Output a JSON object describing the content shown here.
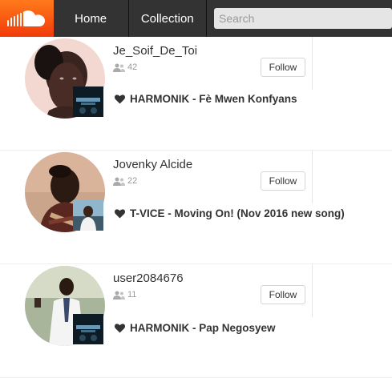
{
  "header": {
    "nav": [
      {
        "label": "Home"
      },
      {
        "label": "Collection"
      }
    ],
    "search": {
      "placeholder": "Search"
    },
    "brand_color": "#f50"
  },
  "users": [
    {
      "username": "Je_Soif_De_Toi",
      "followers": "42",
      "follow_label": "Follow",
      "track": "HARMONIK - Fè Mwen Konfyans"
    },
    {
      "username": "Jovenky Alcide",
      "followers": "22",
      "follow_label": "Follow",
      "track": "T-VICE - Moving On! (Nov 2016 new song)"
    },
    {
      "username": "user2084676",
      "followers": "11",
      "follow_label": "Follow",
      "track": "HARMONIK - Pap Negosyew"
    }
  ]
}
